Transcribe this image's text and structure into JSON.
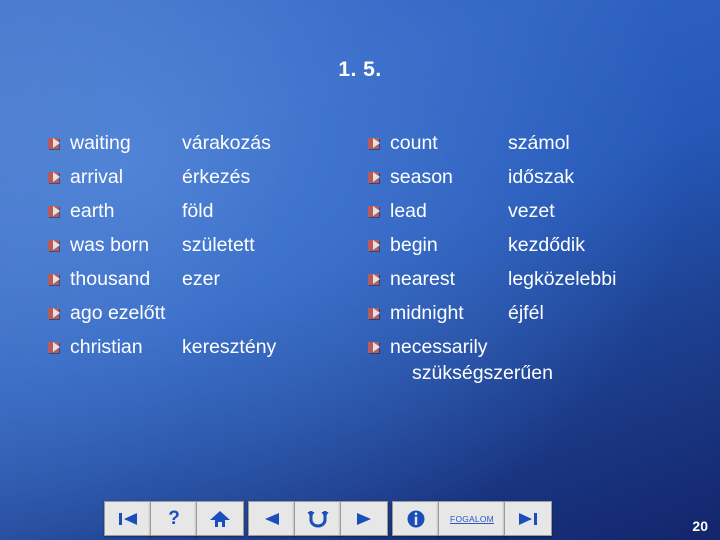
{
  "slide": {
    "title": "1. 5.",
    "page_number": "20"
  },
  "columns": {
    "left": [
      {
        "term": "waiting",
        "translation": "várakozás"
      },
      {
        "term": "arrival",
        "translation": "érkezés"
      },
      {
        "term": "earth",
        "translation": "föld"
      },
      {
        "term": "was born",
        "translation": "született"
      },
      {
        "term": "thousand",
        "translation": "ezer"
      },
      {
        "term": "ago ezelőtt",
        "translation": ""
      },
      {
        "term": "christian",
        "translation": "keresztény"
      }
    ],
    "right": [
      {
        "term": "count",
        "translation": "számol"
      },
      {
        "term": "season",
        "translation": "időszak"
      },
      {
        "term": "lead",
        "translation": "vezet"
      },
      {
        "term": "begin",
        "translation": "kezdődik"
      },
      {
        "term": "nearest",
        "translation": "legközelebbi"
      },
      {
        "term": "midnight",
        "translation": "éjfél"
      },
      {
        "term": "necessarily",
        "translation": "",
        "wrap": "szükségszerűen"
      }
    ]
  },
  "toolbar": {
    "first_label": "◀|",
    "help_label": "?",
    "home_label": "home",
    "back_label": "◀",
    "loop_label": "↺",
    "forward_label": "▶",
    "info_label": "i",
    "fogalom_label": "FOGALOM",
    "last_label": "▶|"
  },
  "colors": {
    "bullet": "#b85a5a",
    "text": "#ffffff",
    "link": "#2a57c4"
  }
}
